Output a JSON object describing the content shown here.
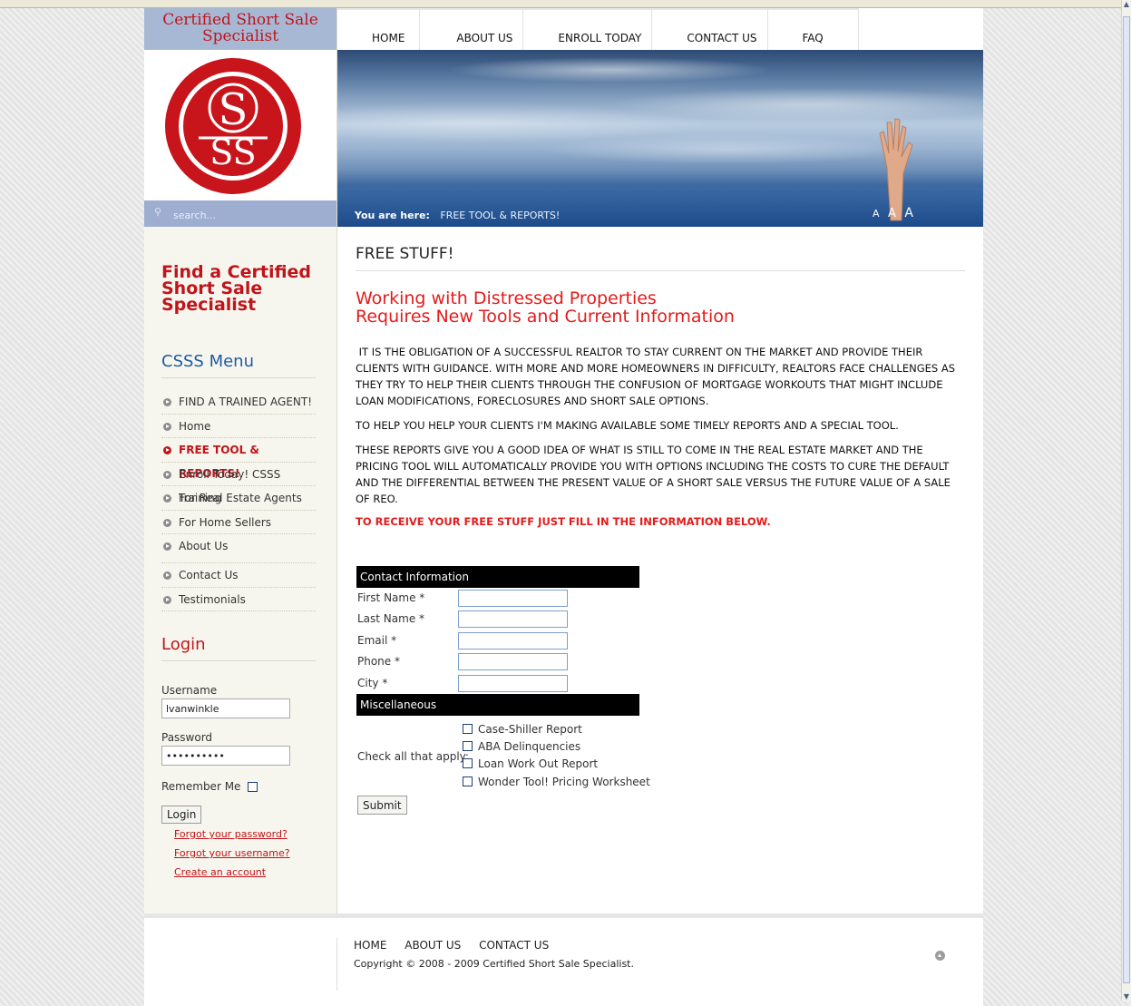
{
  "brand": {
    "line1": "Certified Short Sale",
    "line2": "Specialist",
    "logo_letters_top": "S",
    "logo_letters_bottom": "SS"
  },
  "search": {
    "placeholder": "search..."
  },
  "nav": {
    "items": [
      "HOME",
      "ABOUT US",
      "ENROLL TODAY",
      "CONTACT US",
      "FAQ"
    ]
  },
  "banner": {
    "you_are_here_label": "You are here:",
    "breadcrumb": "FREE TOOL & REPORTS!",
    "font_size_controls": [
      "A",
      "A",
      "A"
    ]
  },
  "sidebar": {
    "find_heading": "Find a Certified Short Sale Specialist",
    "menu_title": "CSSS Menu",
    "menu_items": [
      "FIND A TRAINED AGENT!",
      "Home",
      "FREE TOOL & REPORTS!",
      "Enroll Today! CSSS Training",
      "For Real Estate Agents",
      "For Home Sellers",
      "About Us",
      "Contact Us",
      "Testimonials"
    ],
    "active_item": "FREE TOOL & REPORTS!"
  },
  "login": {
    "title": "Login",
    "username_label": "Username",
    "username_value": "lvanwinkle",
    "password_label": "Password",
    "password_value": "••••••••••",
    "remember_label": "Remember Me",
    "button": "Login",
    "links": [
      "Forgot your password?",
      "Forgot your username?",
      "Create an account"
    ]
  },
  "content": {
    "title": "FREE STUFF!",
    "heading_line1": "Working with Distressed Properties",
    "heading_line2": "Requires New Tools and Current Information",
    "para1": " It is the obligation of a successful Realtor to stay current on the market and provide their clients with guidance. With more and more homeowners in difficulty, Realtors face challenges as they try to help their clients through the confusion of mortgage workouts that might include loan modifications, foreclosures and short sale options.",
    "para2": "To help you help your clients I'm making available some timely reports and a special tool.",
    "para3": "These reports give you a good idea of what is still to come in the real estate market and the pricing tool will automatically provide you with options including the costs to cure the default and the differential between the present value of a short sale versus the future value of a sale of REO.",
    "cta": "TO RECEIVE YOUR FREE STUFF JUST FILL IN THE INFORMATION BELOW."
  },
  "form": {
    "contact_header": "Contact Information",
    "fields": [
      "First Name *",
      "Last Name *",
      "Email *",
      "Phone *",
      "City *"
    ],
    "misc_header": "Miscellaneous",
    "check_label": "Check all that apply:",
    "options": [
      "Case-Shiller Report",
      "ABA Delinquencies",
      "Loan Work Out Report",
      "Wonder Tool! Pricing Worksheet"
    ],
    "submit": "Submit"
  },
  "footer": {
    "links": [
      "HOME",
      "ABOUT US",
      "CONTACT US"
    ],
    "copyright": "Copyright © 2008 - 2009 Certified Short Sale Specialist."
  },
  "colors": {
    "brand_red": "#c0141b",
    "heading_red": "#e41b1b",
    "menu_blue": "#1d5b9f",
    "sidebar_bg": "#f7f6ee",
    "brand_bar": "#a7b8d4"
  }
}
